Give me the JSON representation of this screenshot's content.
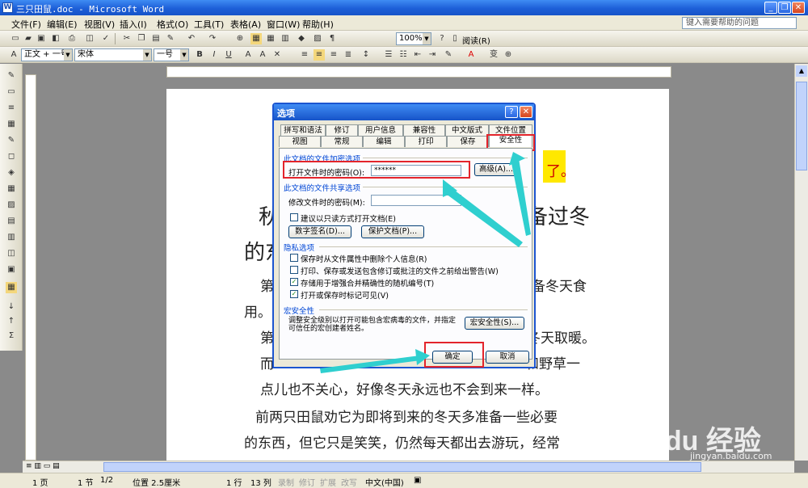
{
  "window": {
    "title": "三只田鼠.doc - Microsoft Word",
    "icon": "word-icon"
  },
  "menu": {
    "items": [
      "文件(F)",
      "编辑(E)",
      "视图(V)",
      "插入(I)",
      "格式(O)",
      "工具(T)",
      "表格(A)",
      "窗口(W)",
      "帮助(H)"
    ],
    "help_placeholder": "键入需要帮助的问题"
  },
  "toolbar": {
    "zoom": "100%",
    "read": "阅读(R)",
    "style": "正文 + 一号",
    "font": "宋体",
    "size": "一号"
  },
  "document": {
    "lines": [
      "秋",
      "备过冬",
      "的东",
      "第",
      "备冬天食",
      "用。",
      "第",
      "冬天取暖。",
      "而",
      "和野草一",
      "点儿也不关心，好像冬天永远也不会到来一样。",
      "前两只田鼠劝它为即将到来的冬天多准备一些必要",
      "的东西，但它只是笑笑，仍然每天都出去游玩，经常"
    ],
    "highlight": "了。"
  },
  "dialog": {
    "title": "选项",
    "tabs_row1": [
      "拼写和语法",
      "修订",
      "用户信息",
      "兼容性",
      "中文版式",
      "文件位置"
    ],
    "tabs_row2": [
      "视图",
      "常规",
      "编辑",
      "打印",
      "保存",
      "安全性"
    ],
    "group1": "此文档的文件加密选项",
    "open_password_label": "打开文件时的密码(O):",
    "open_password_value": "******",
    "advanced": "高级(A)...",
    "group2": "此文档的文件共享选项",
    "modify_password_label": "修改文件时的密码(M):",
    "readonly": "建议以只读方式打开文档(E)",
    "digital_sign": "数字签名(D)...",
    "protect_doc": "保护文档(P)...",
    "group3": "隐私选项",
    "privacy": [
      "保存时从文件属性中删除个人信息(R)",
      "打印、保存或发送包含修订或批注的文件之前给出警告(W)",
      "存储用于增强合并精确性的随机编号(T)",
      "打开或保存时标记可见(V)"
    ],
    "privacy_checked": [
      false,
      false,
      true,
      true
    ],
    "group4": "宏安全性",
    "macro_desc": "调整安全级别以打开可能包含宏病毒的文件，并指定可信任的宏创建者姓名。",
    "macro_button": "宏安全性(S)...",
    "ok": "确定",
    "cancel": "取消"
  },
  "status": {
    "page": "1 页",
    "section": "1 节",
    "pages": "1/2",
    "position": "位置 2.5厘米",
    "line": "1 行",
    "col": "13 列",
    "rec": "录制",
    "trk": "修订",
    "ext": "扩展",
    "ovr": "改写",
    "lang": "中文(中国)"
  },
  "watermark": {
    "brand": "Baidu 经验",
    "url": "jingyan.baidu.com"
  }
}
